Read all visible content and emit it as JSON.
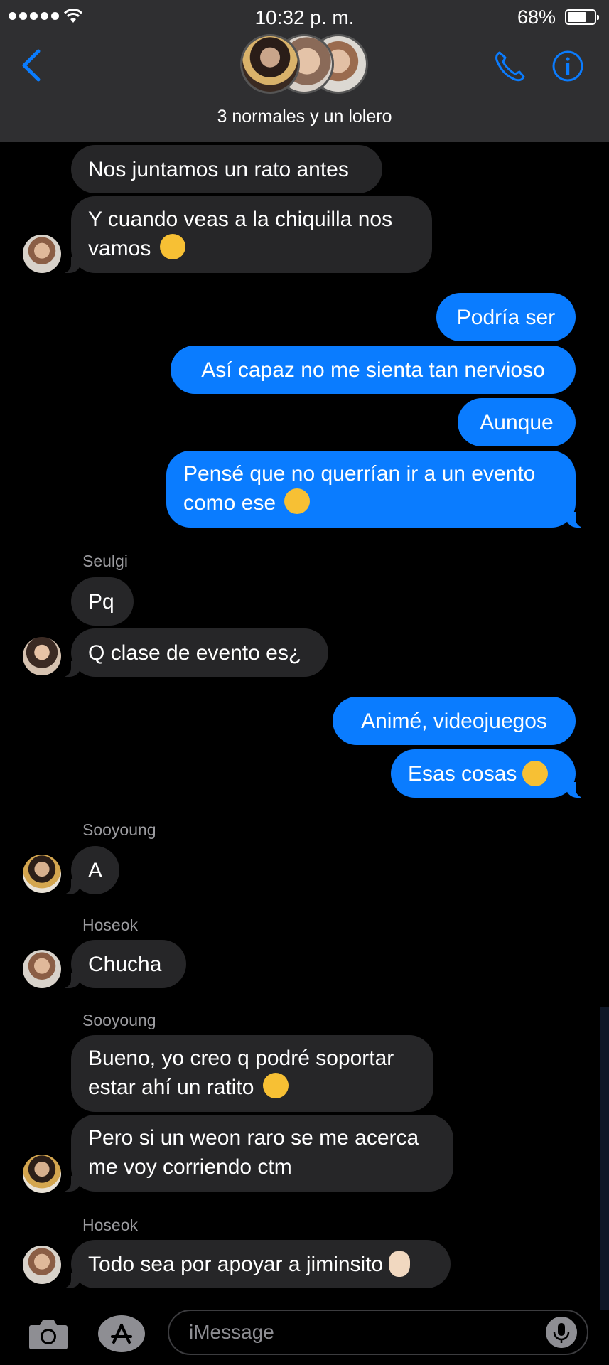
{
  "status": {
    "time": "10:32 p. m.",
    "battery": "68%"
  },
  "header": {
    "group_name": "3 normales y un lolero",
    "icons": {
      "back": "chevron-left-icon",
      "call": "phone-icon",
      "info": "info-icon"
    },
    "accent": "#0a7cff"
  },
  "messages": {
    "m1": "Nos juntamos un rato antes",
    "m2_l1": "Y cuando veas a la chiquilla nos",
    "m2_l2": "vamos",
    "m3": "Podría ser",
    "m4": "Así capaz no me sienta tan nervioso",
    "m5": "Aunque",
    "m6_l1": "Pensé que no querrían ir a un evento",
    "m6_l2": "como ese",
    "sender_seulgi": "Seulgi",
    "m7": "Pq",
    "m8": "Q clase de evento es¿",
    "m9": "Animé, videojuegos",
    "m10": "Esas cosas",
    "sender_sooyoung_1": "Sooyoung",
    "m11": "A",
    "sender_hoseok_1": "Hoseok",
    "m12": "Chucha",
    "sender_sooyoung_2": "Sooyoung",
    "m13_l1": "Bueno, yo creo q podré soportar",
    "m13_l2": "estar ahí un ratito",
    "m14_l1": "Pero si un weon raro se me acerca",
    "m14_l2": "me voy corriendo ctm",
    "sender_hoseok_2": "Hoseok",
    "m15": "Todo sea por apoyar a jiminsito"
  },
  "composer": {
    "placeholder": "iMessage"
  },
  "colors": {
    "incoming": "#262628",
    "outgoing": "#0a7cff",
    "header": "#2f2f31"
  }
}
